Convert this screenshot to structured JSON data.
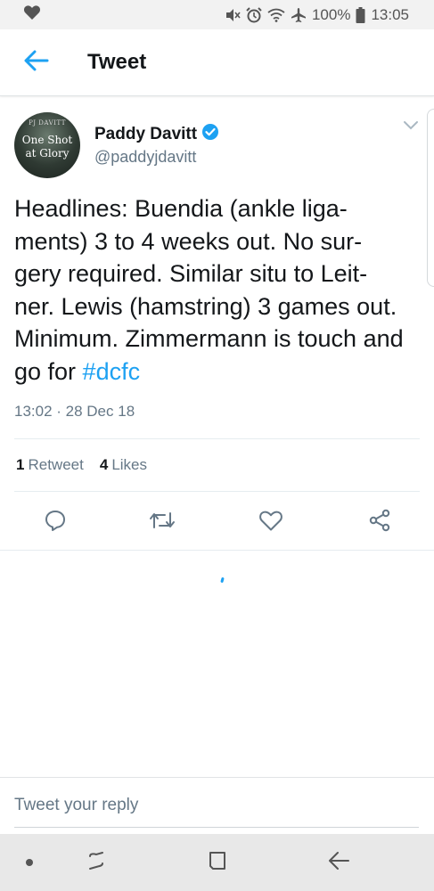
{
  "status_bar": {
    "battery_percent": "100%",
    "time": "13:05",
    "icons": [
      "heart-icon",
      "mute-icon",
      "alarm-icon",
      "wifi-icon",
      "airplane-icon",
      "battery-icon"
    ]
  },
  "app_bar": {
    "title": "Tweet",
    "back_icon": "arrow-left-icon"
  },
  "tweet": {
    "avatar": {
      "top_text": "PJ DAVITT",
      "line1": "One Shot",
      "line2": "at Glory"
    },
    "user_name": "Paddy Davitt",
    "verified": true,
    "handle": "@paddyjdavitt",
    "text": "Headlines: Buendia (ankle liga- ments) 3 to 4 weeks out. No sur- gery required. Similar situ to Leit- ner. Lewis (hamstring) 3 games out. Minimum. Zimmermann is touch and go for ",
    "hashtag": "#dcfc",
    "timestamp": "13:02 · 28 Dec 18",
    "retweet_count": "1",
    "retweet_label": "Retweet",
    "like_count": "4",
    "like_label": "Likes",
    "actions": [
      "reply-icon",
      "retweet-icon",
      "like-icon",
      "share-icon"
    ]
  },
  "reply": {
    "placeholder": "Tweet your reply"
  },
  "nav_bar": {
    "items": [
      "dot-icon",
      "recents-icon",
      "home-icon",
      "back-icon"
    ]
  },
  "colors": {
    "accent": "#1da1f2",
    "text": "#14171a",
    "secondary": "#657786"
  }
}
